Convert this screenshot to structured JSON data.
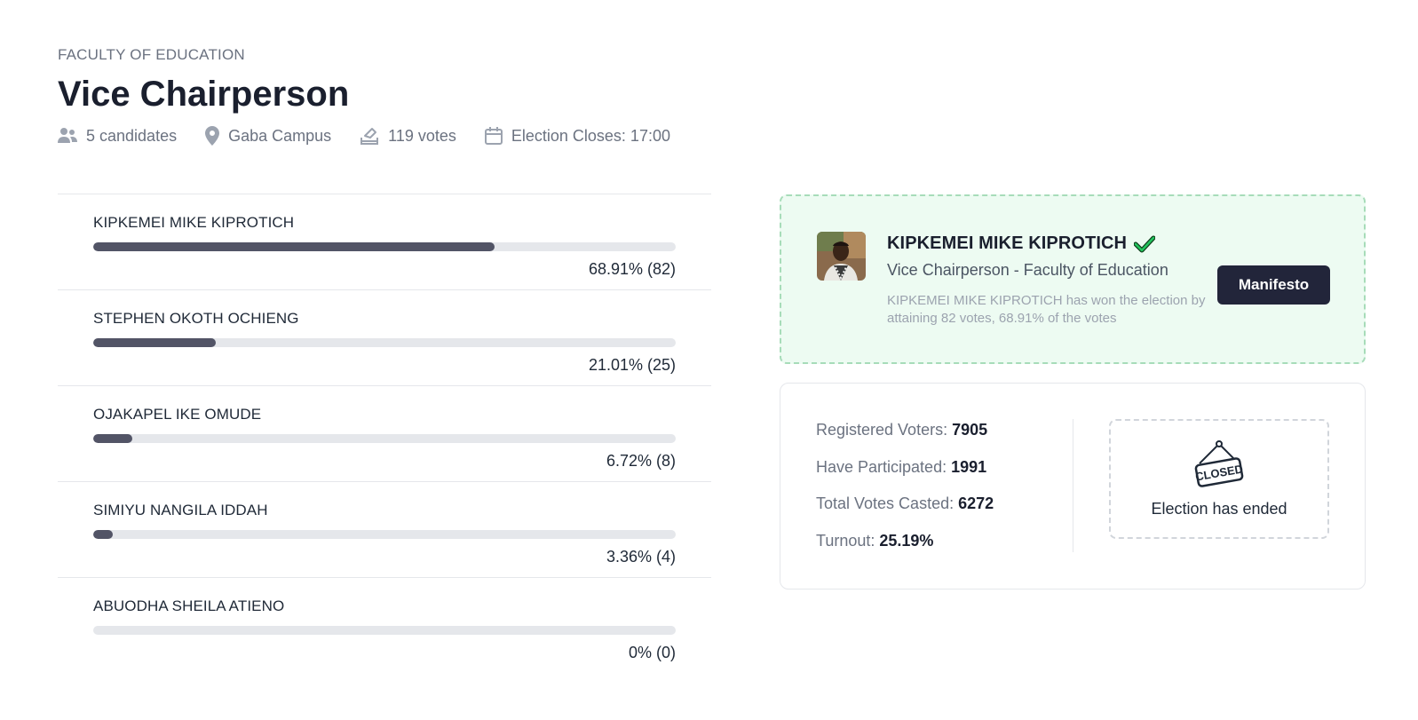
{
  "header": {
    "faculty": "FACULTY OF EDUCATION",
    "title": "Vice Chairperson",
    "meta": {
      "candidates": "5 candidates",
      "campus": "Gaba Campus",
      "votes": "119 votes",
      "closes": "Election Closes: 17:00"
    }
  },
  "candidates": [
    {
      "name": "KIPKEMEI MIKE KIPROTICH",
      "share": 68.91,
      "label": "68.91% (82)"
    },
    {
      "name": "STEPHEN OKOTH OCHIENG",
      "share": 21.01,
      "label": "21.01% (25)"
    },
    {
      "name": "OJAKAPEL IKE OMUDE",
      "share": 6.72,
      "label": "6.72% (8)"
    },
    {
      "name": "SIMIYU NANGILA IDDAH",
      "share": 3.36,
      "label": "3.36% (4)"
    },
    {
      "name": "ABUODHA SHEILA ATIENO",
      "share": 0,
      "label": "0% (0)"
    }
  ],
  "winner": {
    "name": "KIPKEMEI MIKE KIPROTICH",
    "position": "Vice Chairperson - Faculty of Education",
    "description": "KIPKEMEI MIKE KIPROTICH has won the election by attaining 82 votes, 68.91% of the votes",
    "button_label": "Manifesto"
  },
  "stats": {
    "registered_label": "Registered Voters:",
    "registered_value": "7905",
    "participated_label": "Have Participated:",
    "participated_value": "1991",
    "casted_label": "Total Votes Casted:",
    "casted_value": "6272",
    "turnout_label": "Turnout:",
    "turnout_value": "25.19%",
    "closed_sign": "CLOSED",
    "closed_text": "Election has ended"
  },
  "colors": {
    "bar_fill": "#525466",
    "bar_track": "#e5e7eb",
    "winner_bg": "#edfbf2",
    "check": "#16a34a",
    "button_bg": "#22253a"
  }
}
